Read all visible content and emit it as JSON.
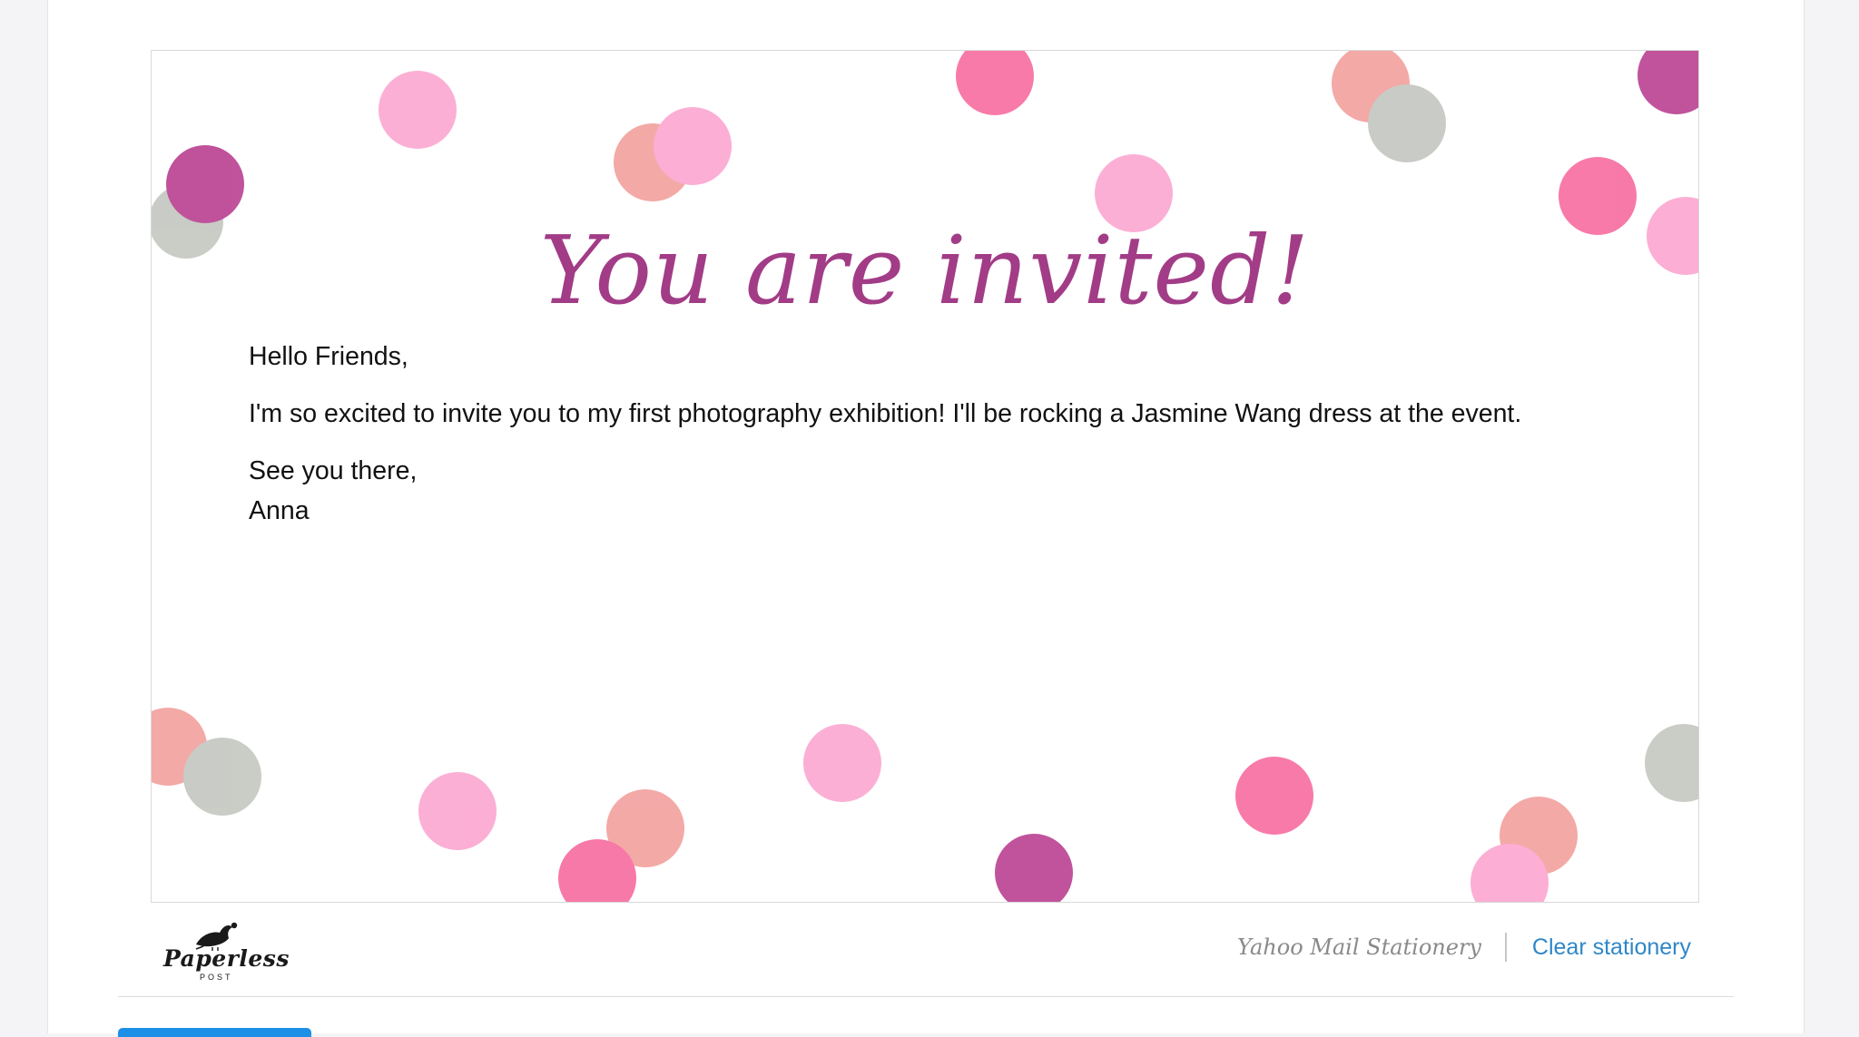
{
  "card": {
    "headline": "You are invited!",
    "greeting": "Hello Friends,",
    "message": "I'm so excited to invite you to my first photography exhibition! I'll be rocking a Jasmine Wang dress at the event.",
    "closing": "See you there,",
    "signature": "Anna"
  },
  "footer": {
    "brand_word": "Paperless",
    "brand_post": "POST",
    "stationery_label": "Yahoo Mail Stationery",
    "clear_link": "Clear stationery"
  },
  "colors": {
    "headline": "#a23c87",
    "link": "#2f87c8",
    "dot_pink": "#fca6d0",
    "dot_hotpink": "#f76b9e",
    "dot_salmon": "#f2a09d",
    "dot_plum": "#b94091",
    "dot_grey": "#c4c6c0",
    "button": "#1e8fe6"
  }
}
